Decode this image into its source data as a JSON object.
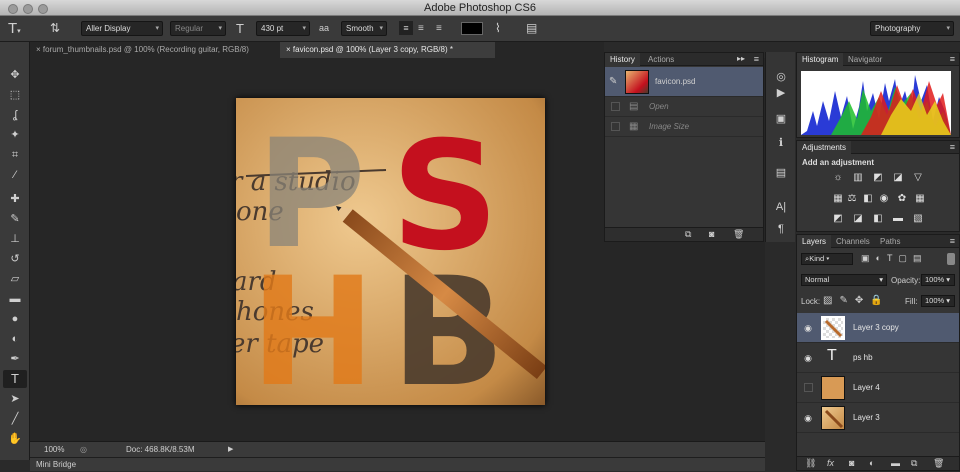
{
  "app": {
    "title": "Adobe Photoshop CS6",
    "workspace": "Photography"
  },
  "options_bar": {
    "tool_icon": "type-tool-icon",
    "font_family": "Aller Display",
    "font_style": "Regular",
    "font_size": "430 pt",
    "antialias_label": "aa",
    "antialias": "Smooth",
    "text_color": "#000000"
  },
  "tabs": [
    {
      "label": "forum_thumbnails.psd @ 100% (Recording guitar, RGB/8)",
      "active": false
    },
    {
      "label": "favicon.psd @ 100% (Layer 3 copy, RGB/8) *",
      "active": true
    }
  ],
  "status": {
    "zoom": "100%",
    "doc": "Doc: 468.8K/8.53M"
  },
  "minibridge": {
    "label": "Mini Bridge"
  },
  "history": {
    "tabs": [
      "History",
      "Actions"
    ],
    "snapshot": "favicon.psd",
    "steps": [
      "Open",
      "Image Size"
    ]
  },
  "histogram": {
    "tabs": [
      "Histogram",
      "Navigator"
    ]
  },
  "adjustments": {
    "title": "Adjustments",
    "subtitle": "Add an adjustment"
  },
  "layers": {
    "tabs": [
      "Layers",
      "Channels",
      "Paths"
    ],
    "filter": "Kind",
    "blend_mode": "Normal",
    "opacity_label": "Opacity:",
    "opacity": "100%",
    "lock_label": "Lock:",
    "fill_label": "Fill:",
    "fill": "100%",
    "items": [
      {
        "name": "Layer 3 copy",
        "visible": true,
        "selected": true,
        "type": "image"
      },
      {
        "name": "ps hb",
        "visible": true,
        "selected": false,
        "type": "text"
      },
      {
        "name": "Layer 4",
        "visible": false,
        "selected": false,
        "type": "image"
      },
      {
        "name": "Layer 3",
        "visible": true,
        "selected": false,
        "type": "image"
      }
    ]
  },
  "canvas": {
    "handwriting": [
      "r a studio",
      "one",
      "ard",
      "hones",
      "er tape"
    ],
    "letters": {
      "p": "P",
      "s": "S",
      "h": "H",
      "b": "B"
    },
    "colors": {
      "red": "#c4101e",
      "orange": "#e07a1a",
      "dark": "#4a3b2c",
      "grey": "#8a8478"
    }
  }
}
